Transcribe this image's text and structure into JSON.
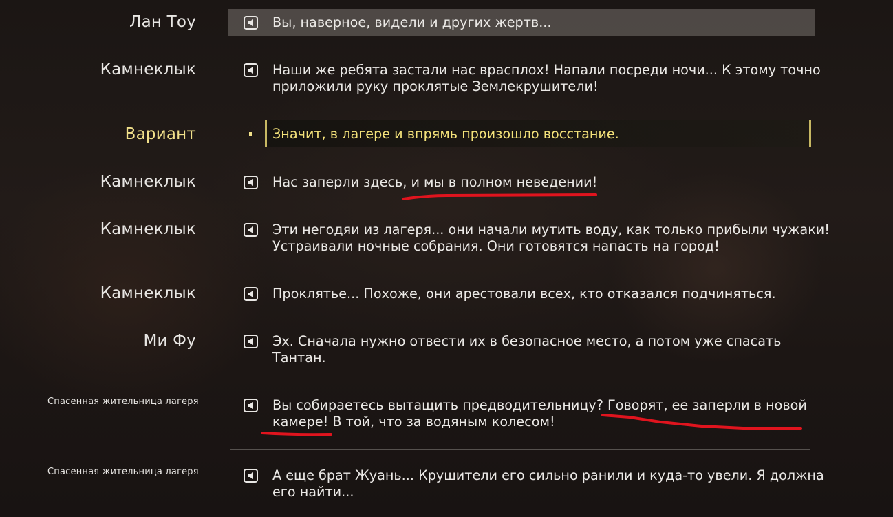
{
  "dialogue": [
    {
      "speaker": "Лан Тоу",
      "lines": [
        "Вы, наверное, видели и других жертв..."
      ]
    },
    {
      "speaker": "Камнеклык",
      "lines": [
        "Наши же ребята застали нас врасплох! Напали посреди ночи... К этому точно",
        "приложили руку проклятые Землекрушители!"
      ]
    },
    {
      "speaker": "Камнеклык",
      "lines": [
        "Нас заперли здесь, и мы в полном неведении!"
      ]
    },
    {
      "speaker": "Камнеклык",
      "lines": [
        "Эти негодяи из лагеря... они начали мутить воду, как только прибыли чужаки!",
        "Устраивали ночные собрания. Они готовятся напасть на город!"
      ]
    },
    {
      "speaker": "Камнеклык",
      "lines": [
        "Проклятье... Похоже, они арестовали всех, кто отказался подчиняться."
      ]
    },
    {
      "speaker": "Ми Фу",
      "lines": [
        "Эх. Сначала нужно отвести их в безопасное место, а потом уже спасать",
        "Тантан."
      ]
    },
    {
      "speaker": "Спасенная жительница лагеря",
      "lines": [
        "Вы собираетесь вытащить предводительницу? Говорят, ее заперли в новой",
        "камере! В той, что за водяным колесом!"
      ]
    },
    {
      "speaker": "Спасенная жительница лагеря",
      "lines": [
        "А еще брат Жуань... Крушители его сильно ранили и куда-то увели. Я должна",
        "его найти..."
      ]
    }
  ],
  "choice": {
    "speaker": "Вариант",
    "text": "Значит, в лагере и впрямь произошло восстание."
  },
  "colors": {
    "accent": "#f1e08a",
    "annotation": "#e0141e",
    "text": "#ebe9e6"
  },
  "icons": {
    "voice": "speaker-play-icon"
  }
}
